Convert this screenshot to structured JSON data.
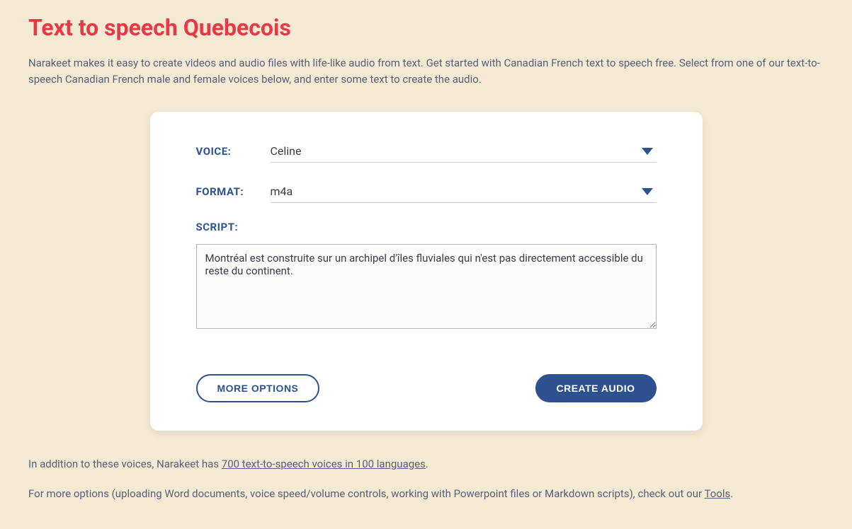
{
  "page": {
    "title": "Text to speech Quebecois",
    "description": "Narakeet makes it easy to create videos and audio files with life-like audio from text. Get started with Canadian French text to speech free. Select from one of our text-to-speech Canadian French male and female voices below, and enter some text to create the audio."
  },
  "form": {
    "voice_label": "VOICE:",
    "voice_value": "Celine",
    "format_label": "FORMAT:",
    "format_value": "m4a",
    "script_label": "SCRIPT:",
    "script_value": "Montréal est construite sur un archipel d'îles fluviales qui n'est pas directement accessible du reste du continent.",
    "more_options_label": "MORE OPTIONS",
    "create_audio_label": "CREATE AUDIO"
  },
  "footer": {
    "line1_pre": "In addition to these voices, Narakeet has ",
    "line1_link": "700 text-to-speech voices in 100 languages",
    "line1_post": ".",
    "line2_pre": "For more options (uploading Word documents, voice speed/volume controls, working with Powerpoint files or Markdown scripts), check out our ",
    "line2_link": "Tools",
    "line2_post": "."
  }
}
